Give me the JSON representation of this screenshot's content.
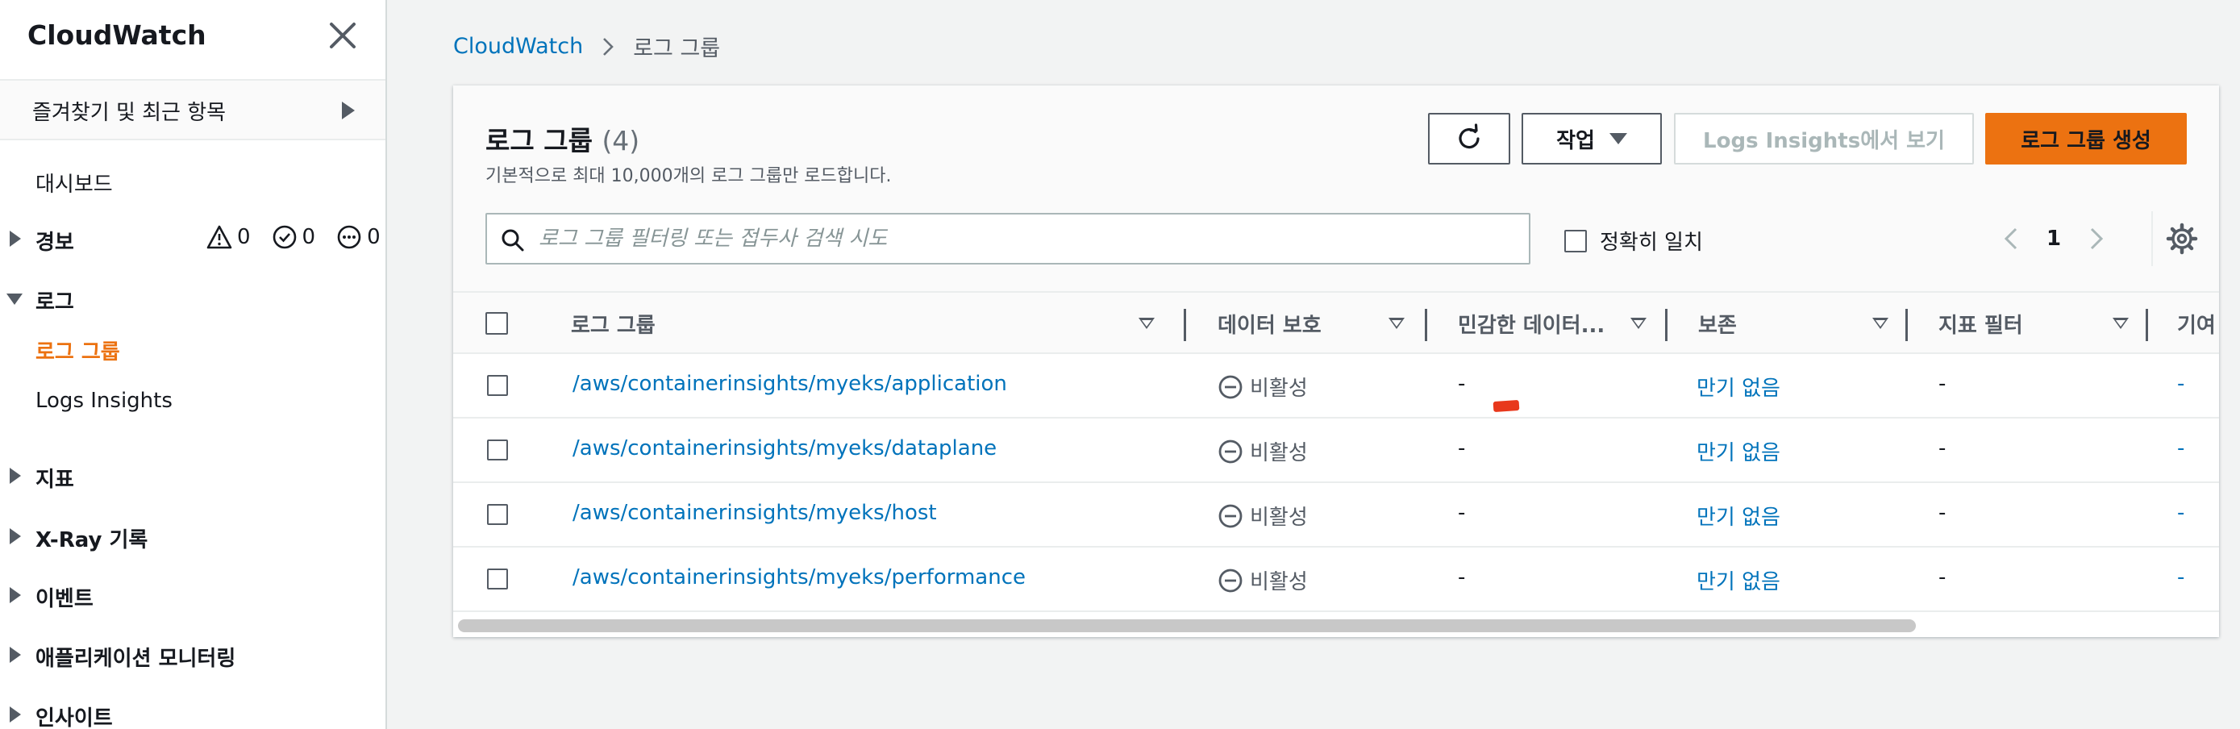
{
  "sidebar": {
    "title": "CloudWatch",
    "close_icon": "close-icon",
    "favorites_label": "즐겨찾기 및 최근 항목",
    "items": [
      {
        "label": "대시보드"
      },
      {
        "label": "경보"
      },
      {
        "label": "로그"
      },
      {
        "label": "로그 그룹"
      },
      {
        "label": "Logs Insights"
      },
      {
        "label": "지표"
      },
      {
        "label": "X-Ray 기록"
      },
      {
        "label": "이벤트"
      },
      {
        "label": "애플리케이션 모니터링"
      },
      {
        "label": "인사이트"
      }
    ],
    "alarm_counts": {
      "alarm": "0",
      "ok": "0",
      "insufficient": "0"
    }
  },
  "breadcrumb": {
    "root": "CloudWatch",
    "current": "로그 그룹"
  },
  "panel": {
    "title": "로그 그룹",
    "count": "(4)",
    "description": "기본적으로 최대 10,000개의 로그 그룹만 로드합니다."
  },
  "buttons": {
    "action": "작업",
    "insights": "Logs Insights에서 보기",
    "create": "로그 그룹 생성"
  },
  "search": {
    "placeholder": "로그 그룹 필터링 또는 접두사 검색 시도",
    "value": ""
  },
  "exact_match": {
    "label": "정확히 일치"
  },
  "pagination": {
    "current_page": "1"
  },
  "table": {
    "columns": [
      "로그 그룹",
      "데이터 보호",
      "민감한 데이터...",
      "보존",
      "지표 필터",
      "기여"
    ],
    "rows": [
      {
        "name": "/aws/containerinsights/myeks/application",
        "protection": "비활성",
        "sensitive": "-",
        "retention": "만기 없음",
        "metric_filter": "-",
        "contrib": "-"
      },
      {
        "name": "/aws/containerinsights/myeks/dataplane",
        "protection": "비활성",
        "sensitive": "-",
        "retention": "만기 없음",
        "metric_filter": "-",
        "contrib": "-"
      },
      {
        "name": "/aws/containerinsights/myeks/host",
        "protection": "비활성",
        "sensitive": "-",
        "retention": "만기 없음",
        "metric_filter": "-",
        "contrib": "-"
      },
      {
        "name": "/aws/containerinsights/myeks/performance",
        "protection": "비활성",
        "sensitive": "-",
        "retention": "만기 없음",
        "metric_filter": "-",
        "contrib": "-"
      }
    ]
  },
  "colors": {
    "accent": "#ec7211",
    "link": "#0073bb",
    "text": "#16191f",
    "muted": "#545b64",
    "annotation_mark": "#e8381c"
  }
}
